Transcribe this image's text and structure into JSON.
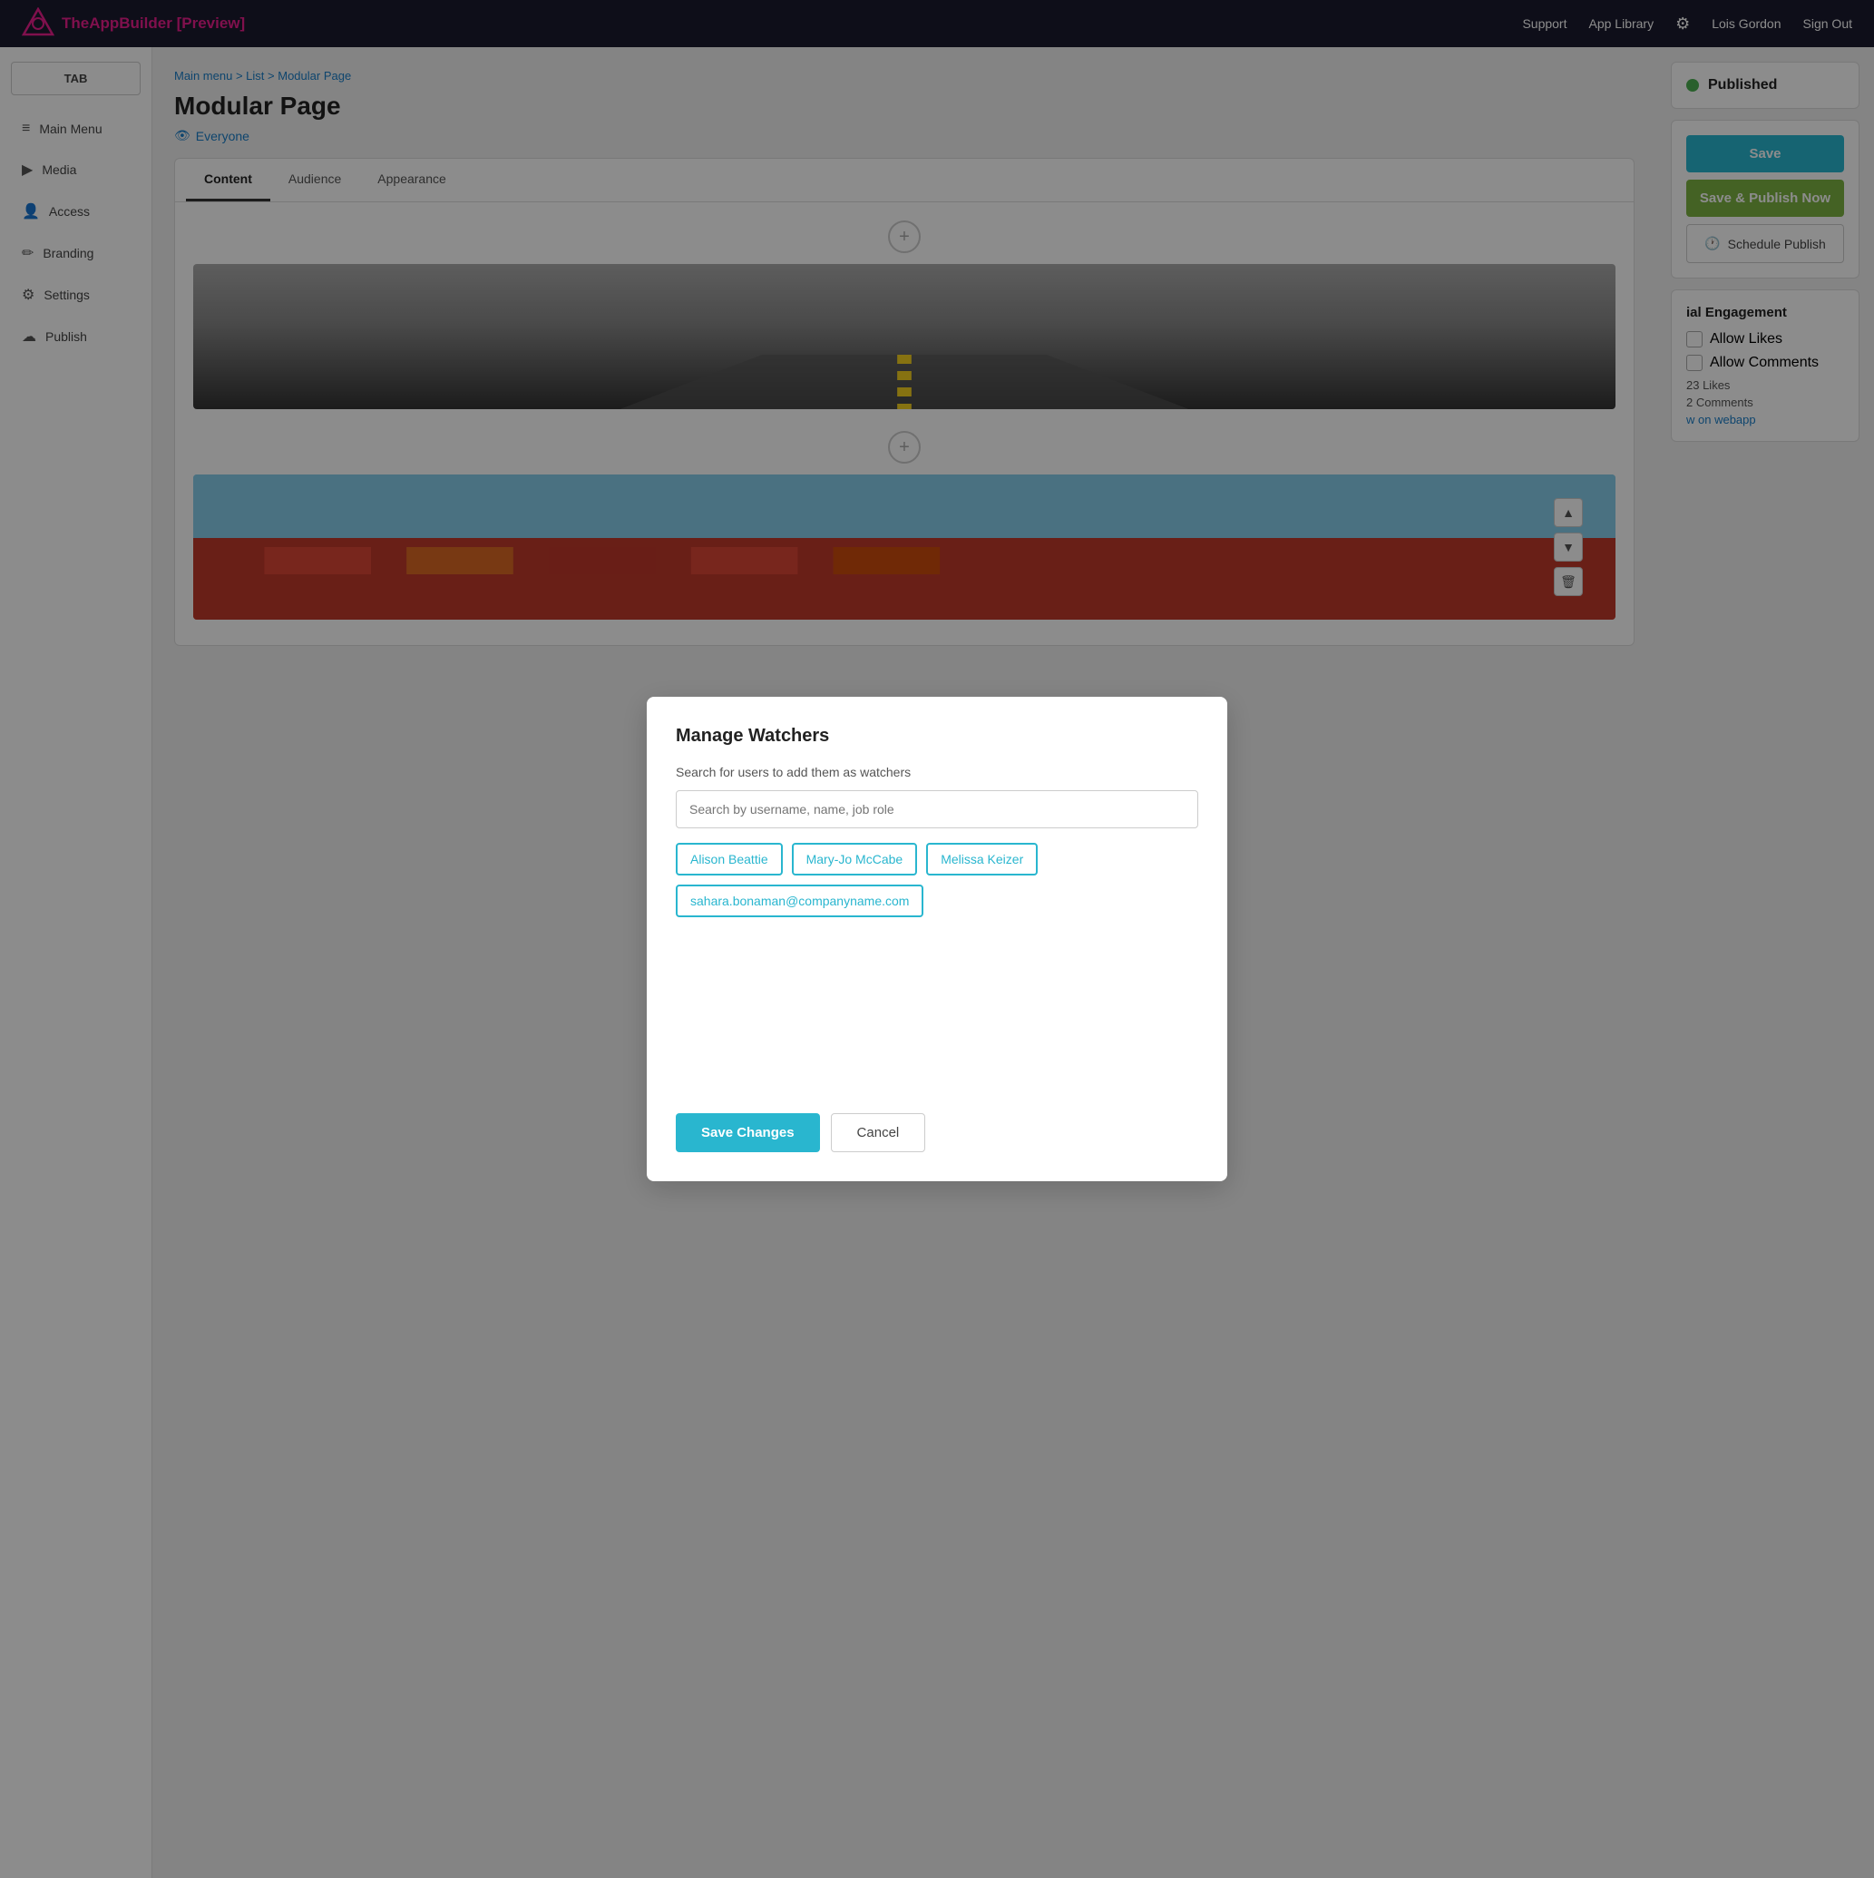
{
  "topnav": {
    "brand": "TheAppBuilder",
    "preview": "[Preview]",
    "links": [
      "Support",
      "App Library",
      "Lois Gordon",
      "Sign Out"
    ]
  },
  "sidebar": {
    "tab_label": "TAB",
    "items": [
      {
        "id": "main-menu",
        "label": "Main Menu",
        "icon": "≡"
      },
      {
        "id": "media",
        "label": "Media",
        "icon": "▶"
      },
      {
        "id": "access",
        "label": "Access",
        "icon": "👤"
      },
      {
        "id": "branding",
        "label": "Branding",
        "icon": "✏"
      },
      {
        "id": "settings",
        "label": "Settings",
        "icon": "⚙"
      },
      {
        "id": "publish",
        "label": "Publish",
        "icon": "☁"
      }
    ]
  },
  "breadcrumb": {
    "parts": [
      "Main menu",
      "List",
      "Modular Page"
    ],
    "separator": " > "
  },
  "page": {
    "title": "Modular Page",
    "visibility": "Everyone",
    "visibility_icon": "👁"
  },
  "tabs": {
    "items": [
      "Content",
      "Audience",
      "Appearance"
    ],
    "active": "Content"
  },
  "status": {
    "label": "Published",
    "color": "#4caf50"
  },
  "actions": {
    "save_label": "Save",
    "publish_now_label": "Save & Publish Now",
    "schedule_label": "Schedule Publish",
    "schedule_icon": "🕐"
  },
  "engagement": {
    "title": "ial Engagement",
    "allow_likes_label": "Allow Likes",
    "allow_comments_label": "Allow Comments",
    "likes_count": "23 Likes",
    "comments_count": "2 Comments",
    "webapp_link": "w on webapp"
  },
  "modal": {
    "title": "Manage Watchers",
    "subtitle": "Search for users to add them as watchers",
    "search_placeholder": "Search by username, name, job role",
    "watchers": [
      "Alison Beattie",
      "Mary-Jo McCabe",
      "Melissa Keizer",
      "sahara.bonaman@companyname.com"
    ],
    "save_label": "Save Changes",
    "cancel_label": "Cancel"
  }
}
